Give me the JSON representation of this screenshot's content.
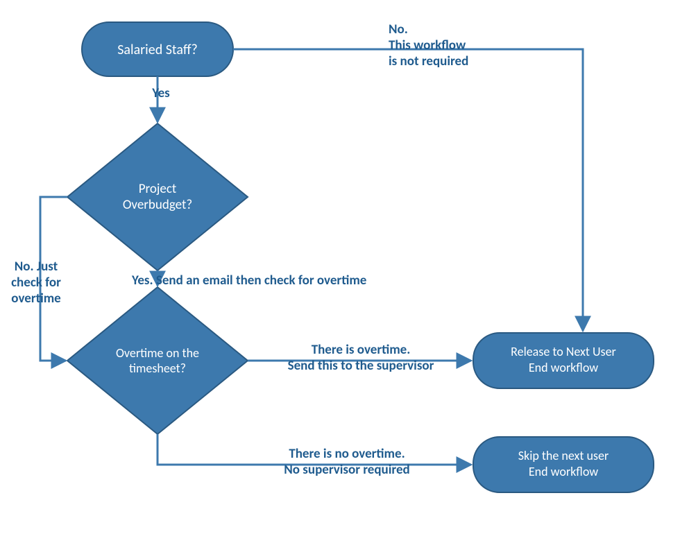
{
  "colors": {
    "fill": "#3d79ad",
    "stroke": "#2a5981",
    "label": "#1f5b8e",
    "shapeText": "#ffffff"
  },
  "nodes": {
    "salaried": {
      "text": "Salaried Staff?"
    },
    "overbudget": {
      "text": "Project\nOverbudget?"
    },
    "overtime": {
      "text": "Overtime on the\ntimesheet?"
    },
    "release": {
      "text": "Release to Next User\nEnd workflow"
    },
    "skip": {
      "text": "Skip the next user\nEnd workflow"
    }
  },
  "edges": {
    "salaried_yes": "Yes",
    "salaried_no": "No.\nThis workflow\nis not required",
    "overbudget_no": "No. Just\ncheck for\novertime",
    "overbudget_yes": "Yes.  Send an email then check for overtime",
    "overtime_yes": "There is overtime.\nSend this to the supervisor",
    "overtime_no": "There is no overtime.\nNo supervisor required"
  }
}
